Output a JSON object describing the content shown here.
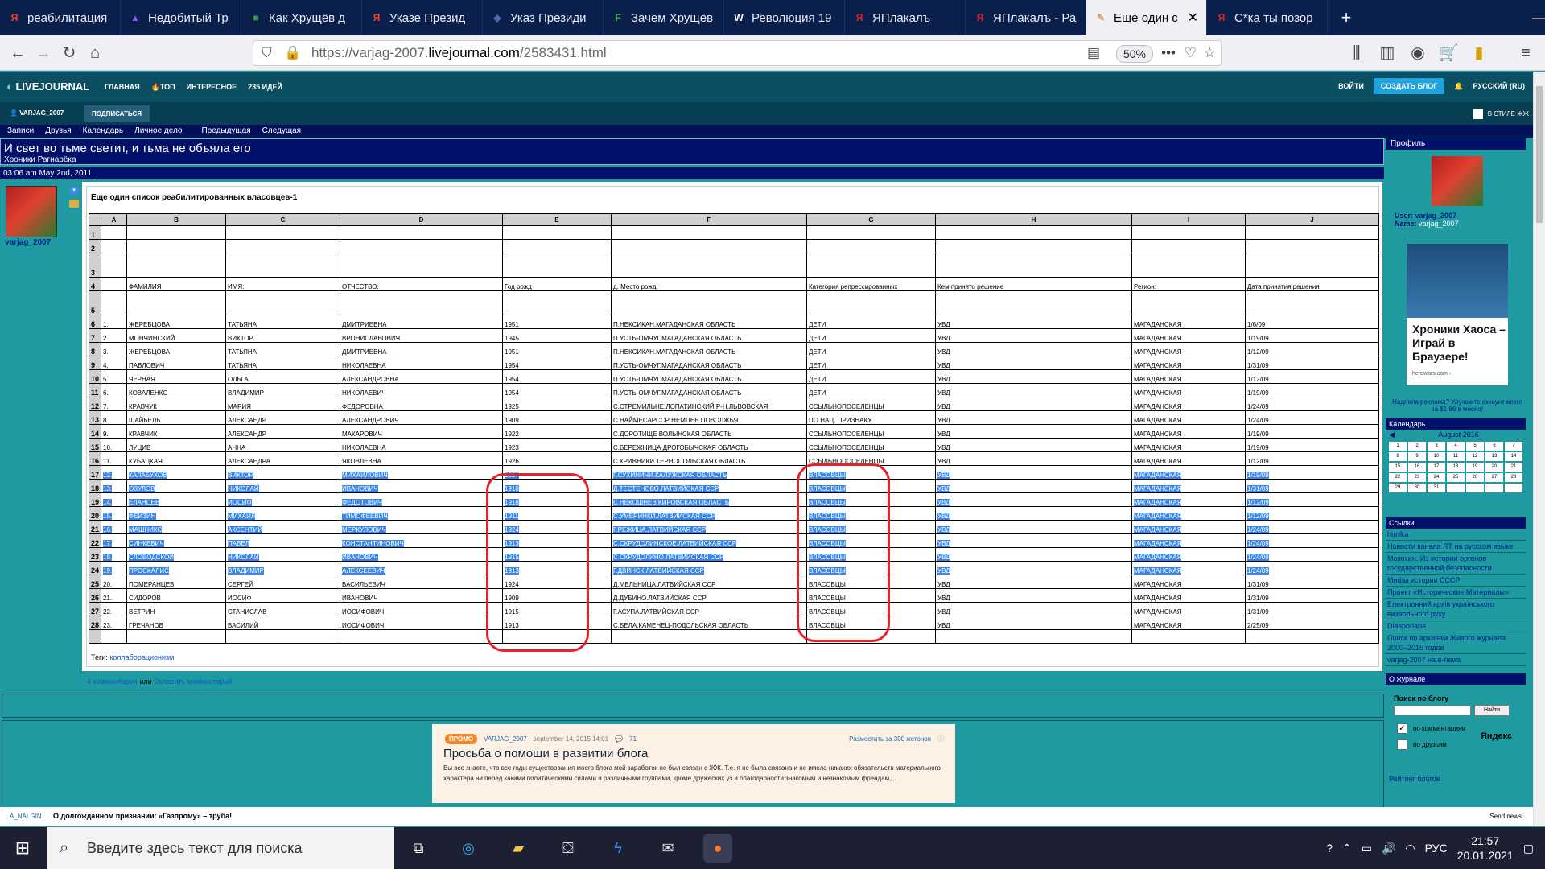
{
  "browser": {
    "tabs": [
      {
        "label": "реабилитация",
        "icon": "Я",
        "color": "#fc3f1d"
      },
      {
        "label": "Недобитый Тр",
        "icon": "▲",
        "color": "#7a5cf0"
      },
      {
        "label": "Как Хрущёв д",
        "icon": "■",
        "color": "#2ea043"
      },
      {
        "label": "Указе Презид",
        "icon": "Я",
        "color": "#fc3f1d"
      },
      {
        "label": "Указ Президи",
        "icon": "◆",
        "color": "#4a6aa8"
      },
      {
        "label": "Зачем Хрущёв",
        "icon": "F",
        "color": "#3cb034"
      },
      {
        "label": "Революция 19",
        "icon": "W",
        "color": "#ffffff"
      },
      {
        "label": "ЯПлакалъ",
        "icon": "Я",
        "color": "#d22"
      },
      {
        "label": "ЯПлакалъ - Ра",
        "icon": "Я",
        "color": "#d22"
      },
      {
        "label": "Еще один с",
        "icon": "✎",
        "color": "#d8a070",
        "active": true
      },
      {
        "label": "С*ка ты позор",
        "icon": "Я",
        "color": "#d22"
      }
    ],
    "url_prefix": "https://varjag-2007.",
    "url_domain": "livejournal.com",
    "url_path": "/2583431.html",
    "zoom": "50%"
  },
  "lj": {
    "logo": "LIVEJOURNAL",
    "nav": [
      "ГЛАВНАЯ",
      "ТОП",
      "ИНТЕРЕСНОЕ",
      "235 ИДЕЙ"
    ],
    "login": "ВОЙТИ",
    "create_blog": "СОЗДАТЬ БЛОГ",
    "language": "РУССКИЙ (RU)",
    "username": "VARJAG_2007",
    "subscribe": "ПОДПИСАТЬСЯ",
    "style_toggle": "В СТИЛЕ ЖЖ"
  },
  "journal": {
    "nav": [
      "Записи",
      "Друзья",
      "Календарь",
      "Личное дело",
      "Предыдущая",
      "Следущая"
    ],
    "title": "И свет во тьме светит, и тьма не объяла его",
    "subtitle": "Хроники Рагнарёка",
    "date": "03:06 am May 2nd, 2011",
    "author": "varjag_2007"
  },
  "post": {
    "title": "Еще один список реабилитированных власовцев-1",
    "columns": [
      "A",
      "B",
      "C",
      "D",
      "E",
      "F",
      "G",
      "H",
      "I",
      "J"
    ],
    "header_row": [
      "",
      "ФАМИЛИЯ",
      "ИМЯ:",
      "ОТЧЕСТВО:",
      "Год рожд",
      "д.  Место рожд.",
      "Категория репрессированных",
      "Кем принято решение",
      "Регион:",
      "Дата принятия решения"
    ],
    "rows": [
      {
        "n": "6",
        "a": "1.",
        "b": "ЖЕРЕБЦОВА",
        "c": "ТАТЬЯНА",
        "d": "ДМИТРИЕВНА",
        "e": "1951",
        "f": "П.НЕКСИКАН.МАГАДАНСКАЯ ОБЛАСТЬ",
        "g": "ДЕТИ",
        "h": "УВД",
        "i": "МАГАДАНСКАЯ",
        "j": "1/6/09"
      },
      {
        "n": "7",
        "a": "2.",
        "b": "МОНЧИНСКИЙ",
        "c": "ВИКТОР",
        "d": "ВРОНИСЛАВОВИЧ",
        "e": "1945",
        "f": "П.УСТЬ-ОМЧУГ.МАГАДАНСКАЯ ОБЛАСТЬ",
        "g": "ДЕТИ",
        "h": "УВД",
        "i": "МАГАДАНСКАЯ",
        "j": "1/19/09"
      },
      {
        "n": "8",
        "a": "3.",
        "b": "ЖЕРЕБЦОВА",
        "c": "ТАТЬЯНА",
        "d": "ДМИТРИЕВНА",
        "e": "1951",
        "f": "П.НЕКСИКАН.МАГАДАНСКАЯ ОБЛАСТЬ",
        "g": "ДЕТИ",
        "h": "УВД",
        "i": "МАГАДАНСКАЯ",
        "j": "1/12/09"
      },
      {
        "n": "9",
        "a": "4.",
        "b": "ПАВЛОВИЧ",
        "c": "ТАТЬЯНА",
        "d": "НИКОЛАЕВНА",
        "e": "1954",
        "f": "П.УСТЬ-ОМЧУГ.МАГАДАНСКАЯ ОБЛАСТЬ",
        "g": "ДЕТИ",
        "h": "УВД",
        "i": "МАГАДАНСКАЯ",
        "j": "1/31/09"
      },
      {
        "n": "10",
        "a": "5.",
        "b": "ЧЕРНАЯ",
        "c": "ОЛЬГА",
        "d": "АЛЕКСАНДРОВНА",
        "e": "1954",
        "f": "П.УСТЬ-ОМЧУГ.МАГАДАНСКАЯ ОБЛАСТЬ",
        "g": "ДЕТИ",
        "h": "УВД",
        "i": "МАГАДАНСКАЯ",
        "j": "1/12/09"
      },
      {
        "n": "11",
        "a": "6.",
        "b": "КОВАЛЕНКО",
        "c": "ВЛАДИМИР",
        "d": "НИКОЛАЕВИЧ",
        "e": "1954",
        "f": "П.УСТЬ-ОМЧУГ.МАГАДАНСКАЯ ОБЛАСТЬ",
        "g": "ДЕТИ",
        "h": "УВД",
        "i": "МАГАДАНСКАЯ",
        "j": "1/19/09"
      },
      {
        "n": "12",
        "a": "7.",
        "b": "КРАВЧУК",
        "c": "МАРИЯ",
        "d": "ФЕДОРОВНА",
        "e": "1925",
        "f": "С.СТРЕМИЛЬНЕ.ЛОПАТИНСКИЙ Р-Н.ЛЬВОВСКАЯ",
        "g": "ССЫЛЬНОПОСЕЛЕНЦЫ",
        "h": "УВД",
        "i": "МАГАДАНСКАЯ",
        "j": "1/24/09"
      },
      {
        "n": "13",
        "a": "8.",
        "b": "ШАЙБЕЛЬ",
        "c": "АЛЕКСАНДР",
        "d": "АЛЕКСАНДРОВИЧ",
        "e": "1909",
        "f": "С.НАЙМЕСАРССР НЕМЦЕВ ПОВОЛЖЬЯ",
        "g": "ПО НАЦ. ПРИЗНАКУ",
        "h": "УВД",
        "i": "МАГАДАНСКАЯ",
        "j": "1/24/09"
      },
      {
        "n": "14",
        "a": "9.",
        "b": "КРАВЧИК",
        "c": "АЛЕКСАНДР",
        "d": "МАКАРОВИЧ",
        "e": "1922",
        "f": "С.ДОРОТИЩЕ ВОЛЫНСКАЯ ОБЛАСТЬ",
        "g": "ССЫЛЬНОПОСЕЛЕНЦЫ",
        "h": "УВД",
        "i": "МАГАДАНСКАЯ",
        "j": "1/19/09"
      },
      {
        "n": "15",
        "a": "10.",
        "b": "ЛУЦИВ",
        "c": "АННА",
        "d": "НИКОЛАЕВНА",
        "e": "1923",
        "f": "С.БЕРЕЖНИЦА ДРОГОБЫЧСКАЯ ОБЛАСТЬ",
        "g": "ССЫЛЬНОПОСЕЛЕНЦЫ",
        "h": "УВД",
        "i": "МАГАДАНСКАЯ",
        "j": "1/19/09"
      },
      {
        "n": "16",
        "a": "11.",
        "b": "КУБАЦКАЯ",
        "c": "АЛЕКСАНДРА",
        "d": "ЯКОВЛЕВНА",
        "e": "1926",
        "f": "С.КРИВНИКИ.ТЕРНОПОЛЬСКАЯ ОБЛАСТЬ",
        "g": "ССЫЛЬНОПОСЕЛЕНЦЫ",
        "h": "УВД",
        "i": "МАГАДАНСКАЯ",
        "j": "1/12/09"
      },
      {
        "n": "17",
        "a": "12.",
        "b": "КАЛАБУХОВ",
        "c": "ВИКТОР",
        "d": "МИХАЙЛОВИЧ",
        "e": "1927",
        "f": "Г.СУХИНИЧИ.КАЛУЖСКАЯ ОБЛАСТЬ",
        "g": "ВЛАСОВЦЫ",
        "h": "УВД",
        "i": "МАГАДАНСКАЯ",
        "j": "1/19/09",
        "sel": true
      },
      {
        "n": "18",
        "a": "13.",
        "b": "ОЗУЛОВ",
        "c": "НИКОЛАЙ",
        "d": "ИВАНОВИЧ",
        "e": "1918",
        "f": "Д.ТЕСТЕНОВО.ЛАТВИЙСКАЯ ССР",
        "g": "ВЛАСОВЦЫ",
        "h": "УВД",
        "i": "МАГАДАНСКАЯ",
        "j": "1/31/09",
        "sel": true
      },
      {
        "n": "19",
        "a": "14.",
        "b": "ЕЛАНЦЕВ",
        "c": "ИОСИФ",
        "d": "ФЕДОТОВИЧ",
        "e": "1918",
        "f": "С.НЕКОШНЕВ.КИРОВСКАЯ ОБЛАСТЬ",
        "g": "ВЛАСОВЦЫ",
        "h": "УВД",
        "i": "МАГАДАНСКАЯ",
        "j": "1/12/09",
        "sel": true
      },
      {
        "n": "20",
        "a": "15.",
        "b": "ФЕЙЗИН",
        "c": "МИХАИЛ",
        "d": "ТИМОФЕЕВИЧ",
        "e": "1911",
        "f": "С.УМЕРИНКИ.ЛАТВИЙСКАЯ ССР",
        "g": "ВЛАСОВЦЫ",
        "h": "УВД",
        "i": "МАГАДАНСКАЯ",
        "j": "1/12/09",
        "sel": true
      },
      {
        "n": "21",
        "a": "16.",
        "b": "МАШНИКС",
        "c": "АКСЕНТИЙ",
        "d": "МЕРКУЛОВИЧ",
        "e": "1924",
        "f": "Г.РЕЖИЦА.ЛАТВИЙСКАЯ ССР",
        "g": "ВЛАСОВЦЫ",
        "h": "УВД",
        "i": "МАГАДАНСКАЯ",
        "j": "1/24/09",
        "sel": true
      },
      {
        "n": "22",
        "a": "17.",
        "b": "СИНКЕВИЧ",
        "c": "ПАВЕЛ",
        "d": "КОНСТАНТИНОВИЧ",
        "e": "1913",
        "f": "С.СКРУДОЛИНСКОЕ.ЛАТВИЙСКАЯ ССР",
        "g": "ВЛАСОВЦЫ",
        "h": "УВД",
        "i": "МАГАДАНСКАЯ",
        "j": "1/24/09",
        "sel": true
      },
      {
        "n": "23",
        "a": "18.",
        "b": "СЛОБОДСКОЙ",
        "c": "НИКОЛАЙ",
        "d": "ИВАНОВИЧ",
        "e": "1915",
        "f": "С.СКРУДОЛИНО.ЛАТВИЙСКАЯ ССР",
        "g": "ВЛАСОВЦЫ",
        "h": "УВД",
        "i": "МАГАДАНСКАЯ",
        "j": "1/24/09",
        "sel": true
      },
      {
        "n": "24",
        "a": "19.",
        "b": "ПРОСКАЛИС",
        "c": "ВЛАДИМИР",
        "d": "АЛЕКСЕЕВИЧ",
        "e": "1913",
        "f": "Г.ДВИНСК.ЛАТВИЙСКАЯ ССР",
        "g": "ВЛАСОВЦЫ",
        "h": "УВД",
        "i": "МАГАДАНСКАЯ",
        "j": "1/24/09",
        "sel": true
      },
      {
        "n": "25",
        "a": "20.",
        "b": "ПОМЕРАНЦЕВ",
        "c": "СЕРГЕЙ",
        "d": "ВАСИЛЬЕВИЧ",
        "e": "1924",
        "f": "Д.МЕЛЬНИЦА.ЛАТВИЙСКАЯ ССР",
        "g": "ВЛАСОВЦЫ",
        "h": "УВД",
        "i": "МАГАДАНСКАЯ",
        "j": "1/31/09"
      },
      {
        "n": "26",
        "a": "21.",
        "b": "СИДОРОВ",
        "c": "ИОСИФ",
        "d": "ИВАНОВИЧ",
        "e": "1909",
        "f": "Д.ДУБИНО.ЛАТВИЙСКАЯ ССР",
        "g": "ВЛАСОВЦЫ",
        "h": "УВД",
        "i": "МАГАДАНСКАЯ",
        "j": "1/31/09"
      },
      {
        "n": "27",
        "a": "22.",
        "b": "ВЕТРИН",
        "c": "СТАНИСЛАВ",
        "d": "ИОСИФОВИЧ",
        "e": "1915",
        "f": "Г.АСУПА.ЛАТВИЙСКАЯ ССР",
        "g": "ВЛАСОВЦЫ",
        "h": "УВД",
        "i": "МАГАДАНСКАЯ",
        "j": "1/31/09"
      },
      {
        "n": "28",
        "a": "23.",
        "b": "ГРЕЧАНОВ",
        "c": "ВАСИЛИЙ",
        "d": "ИОСИФОВИЧ",
        "e": "1913",
        "f": "С.БЕЛА.КАМЕНЕЦ-ПОДОЛЬСКАЯ ОБЛАСТЬ",
        "g": "ВЛАСОВЦЫ",
        "h": "УВД",
        "i": "МАГАДАНСКАЯ",
        "j": "2/25/09"
      }
    ],
    "tags_label": "Теги:",
    "tag": "коллаборационизм",
    "comments": "4 комментария",
    "or": "или",
    "leave_comment": "Оставить комментарий"
  },
  "promo": {
    "badge": "ПРОМО",
    "author": "VARJAG_2007",
    "date": "september 14, 2015 14:01",
    "count": "71",
    "place": "Разместить за 300 жетонов",
    "title": "Просьба о помощи в развитии блога",
    "body": "Вы все знаете, что все годы существования моего блога мой заработок не был связан с ЖЖ. Т.е. я не была связана и не имела никаких обязательств материального характера ни перед какими политическими силами и различными группами, кроме дружеских уз и благодарности знакомым и незнакомым френдам,..."
  },
  "sidebar": {
    "profile": "Профиль",
    "user_label": "User:",
    "user": "varjag_2007",
    "name_label": "Name:",
    "name": "varjag_2007",
    "ad_title": "Хроники Хаоса – Играй в Браузере!",
    "ad_source": "herowars.com ›",
    "ad_note": "Надоела реклама? Улучшите аккаунт всего за $1.66 в месяц!",
    "calendar": "Календарь",
    "month": "August 2016",
    "days": [
      "1",
      "2",
      "3",
      "4",
      "5",
      "6",
      "7",
      "8",
      "9",
      "10",
      "11",
      "12",
      "13",
      "14",
      "15",
      "16",
      "17",
      "18",
      "19",
      "20",
      "21",
      "22",
      "23",
      "24",
      "25",
      "26",
      "27",
      "28",
      "29",
      "30",
      "31"
    ],
    "links_header": "Ссылки",
    "links": [
      "htmlka",
      "Новости канала RT на русском языке",
      "Мозохин. Из истории органов государственной безопасности",
      "Мифы истории СССР",
      "Проект «Исторические Материалы»",
      "Електронний архів українського визвольного руху",
      "Diasporiana",
      "Поиск по архивам Живого журнала 2000–2015 годов",
      "varjag-2007 на e-news"
    ],
    "about": "О журнале",
    "search_label": "Поиск по блогу",
    "search_btn": "Найти",
    "by_comments": "по комментариям",
    "by_friends": "по друзьям",
    "yandex": "Яндекс",
    "rating": "Рейтинг блогов"
  },
  "newsbar": {
    "author": "A_NALGIN",
    "headline": "О долгожданном признании: «Газпрому» – труба!",
    "send": "Send news"
  },
  "taskbar": {
    "search_placeholder": "Введите здесь текст для поиска",
    "lang": "РУС",
    "time": "21:57",
    "date": "20.01.2021"
  }
}
